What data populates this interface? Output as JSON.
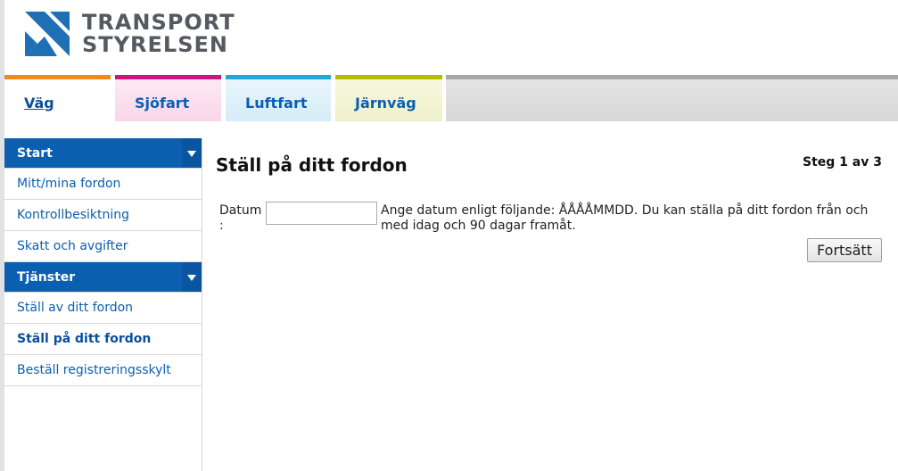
{
  "brand": {
    "line1": "TRANSPORT",
    "line2": "STYRELSEN",
    "colors": {
      "logo_blue": "#1f6fb5",
      "logo_text": "#555a60"
    }
  },
  "tabs": [
    {
      "label": "Väg",
      "active": true,
      "color": "#f08a1c"
    },
    {
      "label": "Sjöfart",
      "color": "#c8167d"
    },
    {
      "label": "Luftfart",
      "color": "#21a7de"
    },
    {
      "label": "Järnväg",
      "color": "#b5bd00"
    }
  ],
  "sidebar": {
    "sections": [
      {
        "title": "Start",
        "items": [
          "Mitt/mina fordon",
          "Kontrollbesiktning",
          "Skatt och avgifter"
        ]
      },
      {
        "title": "Tjänster",
        "items": [
          "Ställ av ditt fordon",
          "Ställ på ditt fordon",
          "Beställ registreringsskylt"
        ],
        "active_index": 1
      }
    ]
  },
  "main": {
    "title": "Ställ på ditt fordon",
    "step": "Steg 1 av 3",
    "date_label": "Datum :",
    "date_value": "",
    "help_text": "Ange datum enligt följande: ÅÅÅÅMMDD. Du kan ställa på ditt fordon från och med idag och 90 dagar framåt.",
    "continue_label": "Fortsätt"
  },
  "colors": {
    "accent": "#0b5fb0"
  }
}
